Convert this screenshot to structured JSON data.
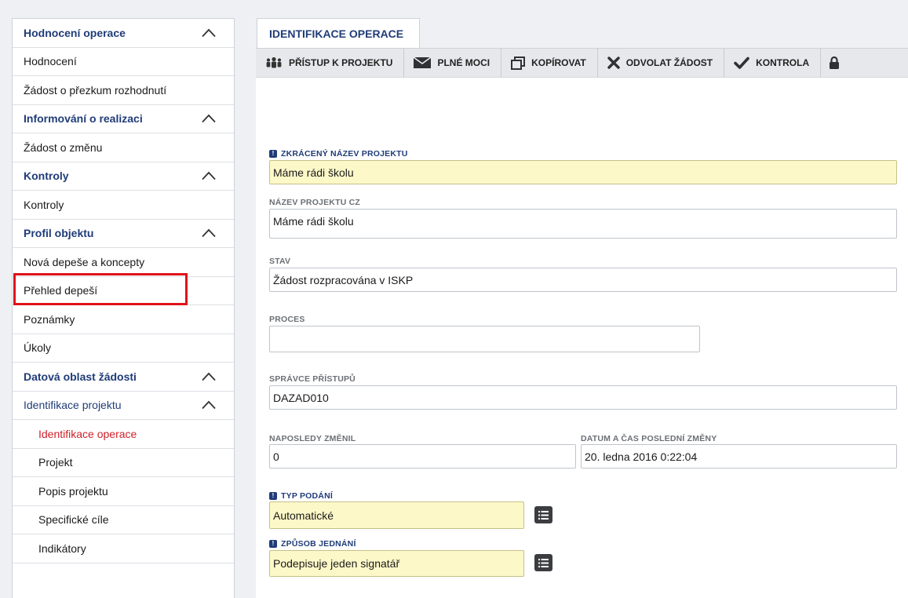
{
  "sidebar": {
    "items": [
      {
        "label": "Hodnocení operace",
        "kind": "section",
        "chevron": "chevron-up-icon"
      },
      {
        "label": "Hodnocení",
        "kind": "item"
      },
      {
        "label": "Žádost o přezkum rozhodnutí",
        "kind": "item"
      },
      {
        "label": "Informování o realizaci",
        "kind": "section",
        "chevron": "chevron-up-icon"
      },
      {
        "label": "Žádost o změnu",
        "kind": "item"
      },
      {
        "label": "Kontroly",
        "kind": "section",
        "chevron": "chevron-up-icon"
      },
      {
        "label": "Kontroly",
        "kind": "item"
      },
      {
        "label": "Profil objektu",
        "kind": "section",
        "chevron": "chevron-up-icon"
      },
      {
        "label": "Nová depeše a koncepty",
        "kind": "item",
        "highlighted": true
      },
      {
        "label": "Přehled depeší",
        "kind": "item"
      },
      {
        "label": "Poznámky",
        "kind": "item"
      },
      {
        "label": "Úkoly",
        "kind": "item"
      },
      {
        "label": "Datová oblast žádosti",
        "kind": "section",
        "chevron": "chevron-up-icon"
      },
      {
        "label": "Identifikace projektu",
        "kind": "group",
        "chevron": "chevron-up-icon"
      },
      {
        "label": "Identifikace operace",
        "kind": "sub",
        "active": true
      },
      {
        "label": "Projekt",
        "kind": "sub"
      },
      {
        "label": "Popis projektu",
        "kind": "sub"
      },
      {
        "label": "Specifické cíle",
        "kind": "sub"
      },
      {
        "label": "Indikátory",
        "kind": "sub"
      }
    ]
  },
  "tab": {
    "label": "IDENTIFIKACE OPERACE"
  },
  "toolbar": {
    "buttons": [
      {
        "label": "PŘÍSTUP K PROJEKTU",
        "icon": "users-icon"
      },
      {
        "label": "PLNÉ MOCI",
        "icon": "envelope-icon"
      },
      {
        "label": "KOPÍROVAT",
        "icon": "copy-icon"
      },
      {
        "label": "ODVOLAT ŽÁDOST",
        "icon": "x-icon"
      },
      {
        "label": "KONTROLA",
        "icon": "check-icon"
      }
    ]
  },
  "form": {
    "short_name": {
      "label": "ZKRÁCENÝ NÁZEV PROJEKTU",
      "value": "Máme rádi školu"
    },
    "name_cz": {
      "label": "NÁZEV PROJEKTU CZ",
      "value": "Máme rádi školu"
    },
    "status": {
      "label": "STAV",
      "value": "Žádost rozpracována v ISKP"
    },
    "process": {
      "label": "PROCES",
      "value": ""
    },
    "access_admin": {
      "label": "SPRÁVCE PŘÍSTUPŮ",
      "value": "DAZAD010"
    },
    "last_changed_by": {
      "label": "NAPOSLEDY ZMĚNIL",
      "value": "0"
    },
    "last_change_time": {
      "label": "DATUM A ČAS POSLEDNÍ ZMĚNY",
      "value": "20. ledna 2016 0:22:04"
    },
    "submission_type": {
      "label": "TYP PODÁNÍ",
      "value": "Automatické"
    },
    "conduct_method": {
      "label": "ZPŮSOB JEDNÁNÍ",
      "value": "Podepisuje jeden signatář"
    }
  },
  "colors": {
    "accent": "#1f3c78",
    "active": "#d0202a",
    "highlight": "#e0121a",
    "required_field": "#fdf8c8"
  }
}
